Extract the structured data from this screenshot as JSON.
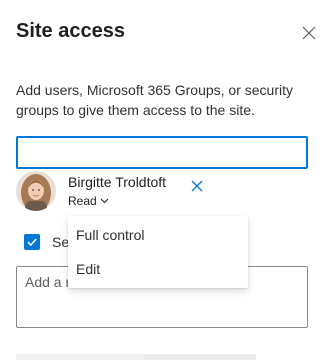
{
  "panel": {
    "title": "Site access",
    "description": "Add users, Microsoft 365 Groups, or security groups to give them access to the site.",
    "close_icon": "close-icon"
  },
  "people_picker": {
    "value": "",
    "placeholder": ""
  },
  "selected_user": {
    "name": "Birgitte Troldtoft",
    "permission": "Read",
    "avatar": "user-photo",
    "remove_icon": "close-icon",
    "chevron_icon": "chevron-down-icon"
  },
  "notify_checkbox": {
    "checked": true,
    "label": "Se"
  },
  "message": {
    "placeholder": "Add a m"
  },
  "permission_menu": {
    "items": [
      {
        "label": "Full control"
      },
      {
        "label": "Edit"
      }
    ]
  },
  "colors": {
    "accent": "#0078d4",
    "text": "#323130",
    "border": "#8a8886"
  }
}
